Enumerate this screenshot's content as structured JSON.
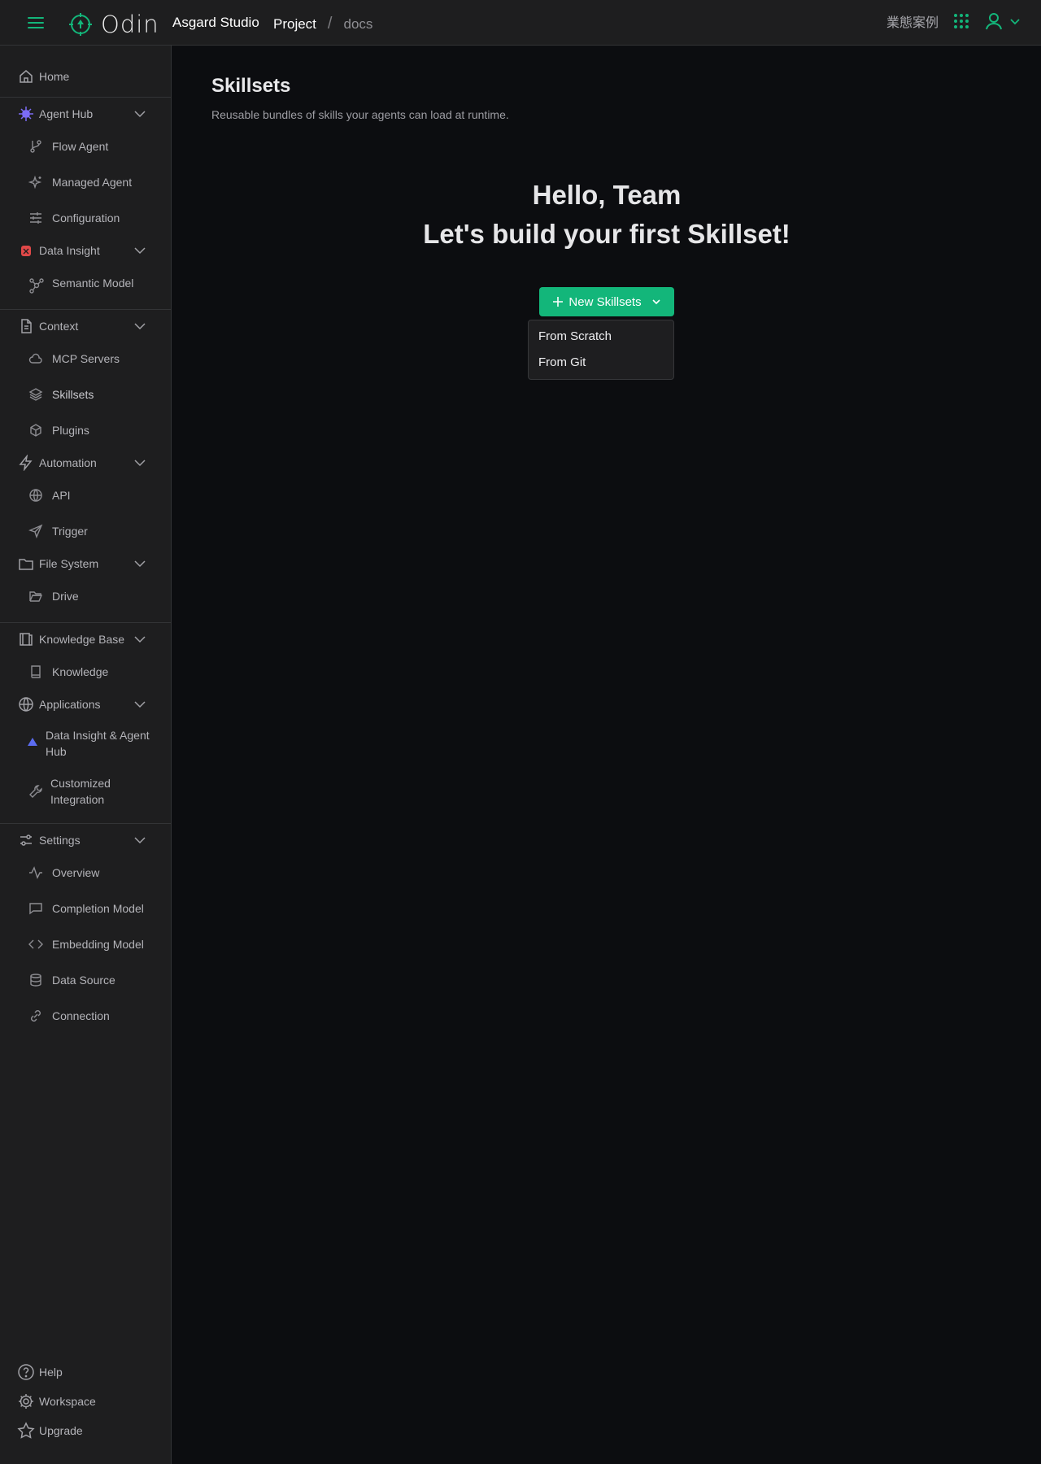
{
  "topbar": {
    "brand": "Odin",
    "org": "Asgard Studio",
    "breadcrumb": {
      "project": "Project",
      "separator": "/",
      "current": "docs"
    },
    "link_label": "業態案例",
    "accent": "#13b67a"
  },
  "sidebar": {
    "home": "Home",
    "agent_hub": {
      "label": "Agent Hub",
      "items": [
        "Flow Agent",
        "Managed Agent",
        "Configuration"
      ]
    },
    "data_insight": {
      "label": "Data Insight",
      "items": [
        "Semantic Model"
      ]
    },
    "context": {
      "label": "Context",
      "items": [
        "MCP Servers",
        "Skillsets",
        "Plugins"
      ]
    },
    "automation": {
      "label": "Automation",
      "items": [
        "API",
        "Trigger"
      ]
    },
    "file_system": {
      "label": "File System",
      "items": [
        "Drive"
      ]
    },
    "knowledge_base": {
      "label": "Knowledge Base",
      "items": [
        "Knowledge"
      ]
    },
    "applications": {
      "label": "Applications",
      "items": [
        "Data Insight & Agent Hub",
        "Customized Integration"
      ]
    },
    "settings": {
      "label": "Settings",
      "items": [
        "Overview",
        "Completion Model",
        "Embedding Model",
        "Data Source",
        "Connection"
      ]
    },
    "bottom": {
      "help": "Help",
      "workspace": "Workspace",
      "upgrade": "Upgrade"
    }
  },
  "main": {
    "title": "Skillsets",
    "description": "Reusable bundles of skills your agents can load at runtime.",
    "greeting": "Hello, Team",
    "cta_heading": "Let's build your first Skillset!",
    "new_button": "New Skillsets",
    "dropdown": [
      "From Scratch",
      "From Git"
    ]
  }
}
